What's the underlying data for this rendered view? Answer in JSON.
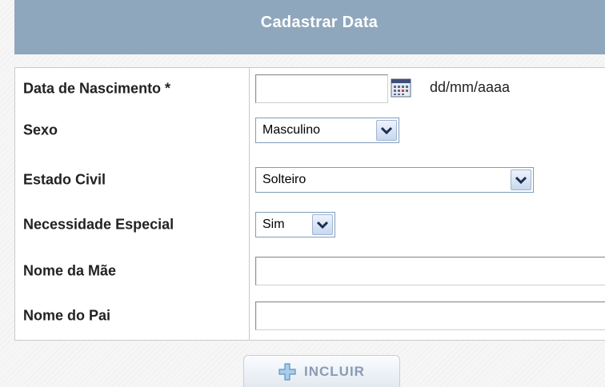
{
  "header": {
    "title": "Cadastrar Data"
  },
  "form": {
    "birth_date": {
      "label": "Data de Nascimento *",
      "value": "",
      "format_hint": "dd/mm/aaaa"
    },
    "sex": {
      "label": "Sexo",
      "selected": "Masculino"
    },
    "marital_status": {
      "label": "Estado Civil",
      "selected": "Solteiro"
    },
    "special_need": {
      "label": "Necessidade Especial",
      "selected": "Sim"
    },
    "mother_name": {
      "label": "Nome da Mãe",
      "value": ""
    },
    "father_name": {
      "label": "Nome do Pai",
      "value": ""
    }
  },
  "actions": {
    "submit_label": "INCLUIR"
  },
  "icons": {
    "calendar": "calendar-icon",
    "dropdown": "chevron-down-icon",
    "add": "plus-icon"
  },
  "colors": {
    "header_bg": "#8fa7bd",
    "button_text": "#8a9bb4",
    "plus_icon": "#7fb0d8"
  }
}
